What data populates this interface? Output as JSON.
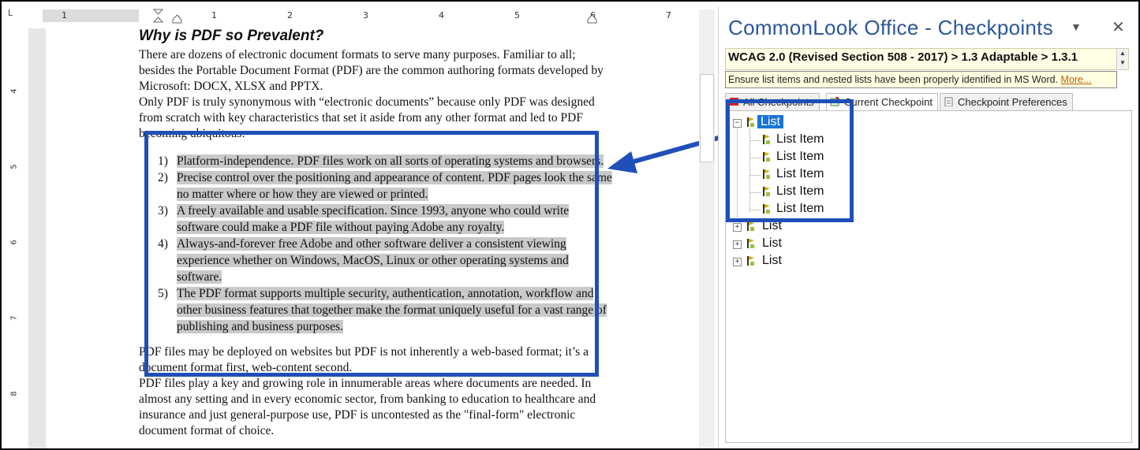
{
  "ruler": {
    "corner": "L",
    "h_numbers": [
      "1",
      "1",
      "2",
      "3",
      "4",
      "5",
      "6",
      "7"
    ],
    "v_numbers": [
      "4",
      "5",
      "6",
      "7",
      "8"
    ]
  },
  "doc": {
    "heading": "Why is PDF so Prevalent?",
    "intro": [
      "There are dozens of electronic document formats to serve many purposes. Familiar to all; besides the Portable Document Format (PDF) are the common authoring formats developed by Microsoft: DOCX, XLSX and PPTX.",
      "Only PDF is truly synonymous with “electronic documents” because only PDF was designed from scratch with key characteristics that set it aside from any other format and led to PDF becoming ubiquitous:"
    ],
    "list": [
      {
        "num": "1)",
        "text": "Platform-independence. PDF files work on all sorts of operating systems and browsers."
      },
      {
        "num": "2)",
        "text": "Precise control over the positioning and appearance of content. PDF pages look the same no matter where or how they are viewed or printed."
      },
      {
        "num": "3)",
        "text": "A freely available and usable specification. Since 1993, anyone who could write software could make a PDF file without paying Adobe any royalty."
      },
      {
        "num": "4)",
        "text": "Always-and-forever free Adobe and other software deliver a consistent viewing experience whether on Windows, MacOS, Linux or other operating systems and software."
      },
      {
        "num": "5)",
        "text": "The PDF format supports multiple security, authentication, annotation, workflow and other business features that together make the format uniquely useful for a vast range of publishing and business purposes."
      }
    ],
    "outro": [
      "PDF files may be deployed on websites but PDF is not inherently a web-based format; it’s a document format first, web-content second.",
      "PDF files play a key and growing role in innumerable areas where documents are needed. In almost any setting and in every economic sector, from banking to education to healthcare and insurance and just general-purpose use, PDF is uncontested as the \"final-form\" electronic document format of choice."
    ]
  },
  "panel": {
    "title": "CommonLook Office - Checkpoints",
    "dropdown_icon": "triangle-down-icon",
    "close_icon": "close-icon",
    "checkpoint": "WCAG 2.0 (Revised Section 508 - 2017) > 1.3 Adaptable > 1.3.1",
    "tooltip": "Ensure list items and nested lists have been properly identified in MS Word.",
    "tooltip_more": "More...",
    "tabs": [
      "All Checkpoints",
      "Current Checkpoint",
      "Checkpoint Preferences"
    ],
    "tree": {
      "root": "List",
      "children": [
        "List Item",
        "List Item",
        "List Item",
        "List Item",
        "List Item"
      ],
      "siblings": [
        "List",
        "List",
        "List"
      ]
    }
  },
  "colors": {
    "callout": "#1f4fb8",
    "selection": "#1874d6",
    "title": "#2b579a",
    "highlight": "#c9c9c9"
  }
}
